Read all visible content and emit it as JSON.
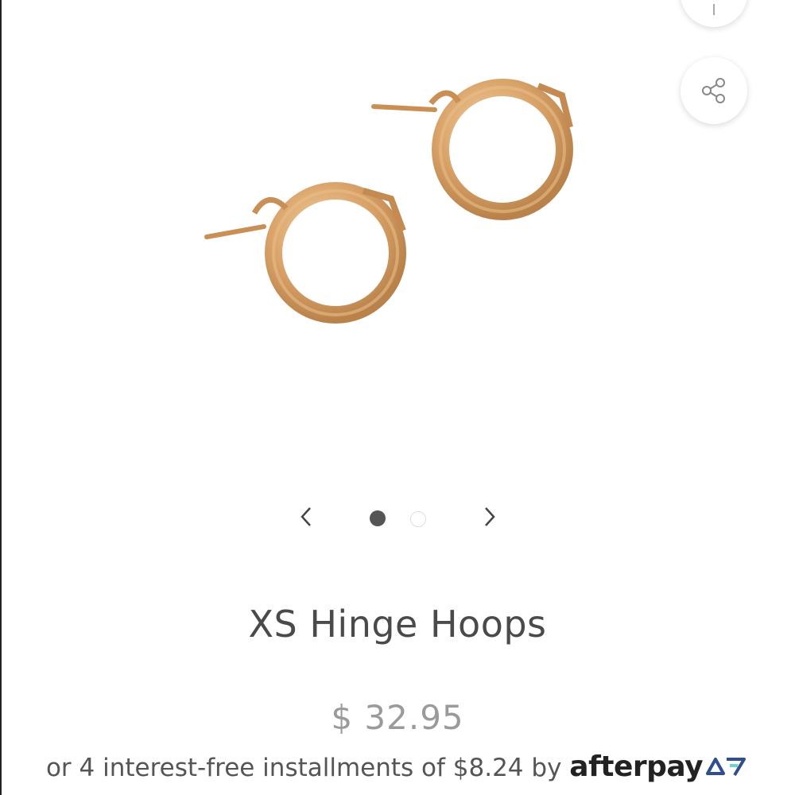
{
  "product": {
    "title": "XS Hinge Hoops",
    "price": "$ 32.95",
    "installments_text": "or 4 interest-free installments of $8.24 by",
    "afterpay_brand": "afterpay"
  },
  "carousel": {
    "total_slides": 2,
    "active_slide": 1
  },
  "icons": {
    "prev": "chevron-left-icon",
    "next": "chevron-right-icon",
    "share": "share-icon"
  },
  "colors": {
    "gold": "#d9a36a",
    "text": "#4a4a4a",
    "price": "#9a9a9a",
    "afterpay_accent": "#3a5a9a"
  }
}
